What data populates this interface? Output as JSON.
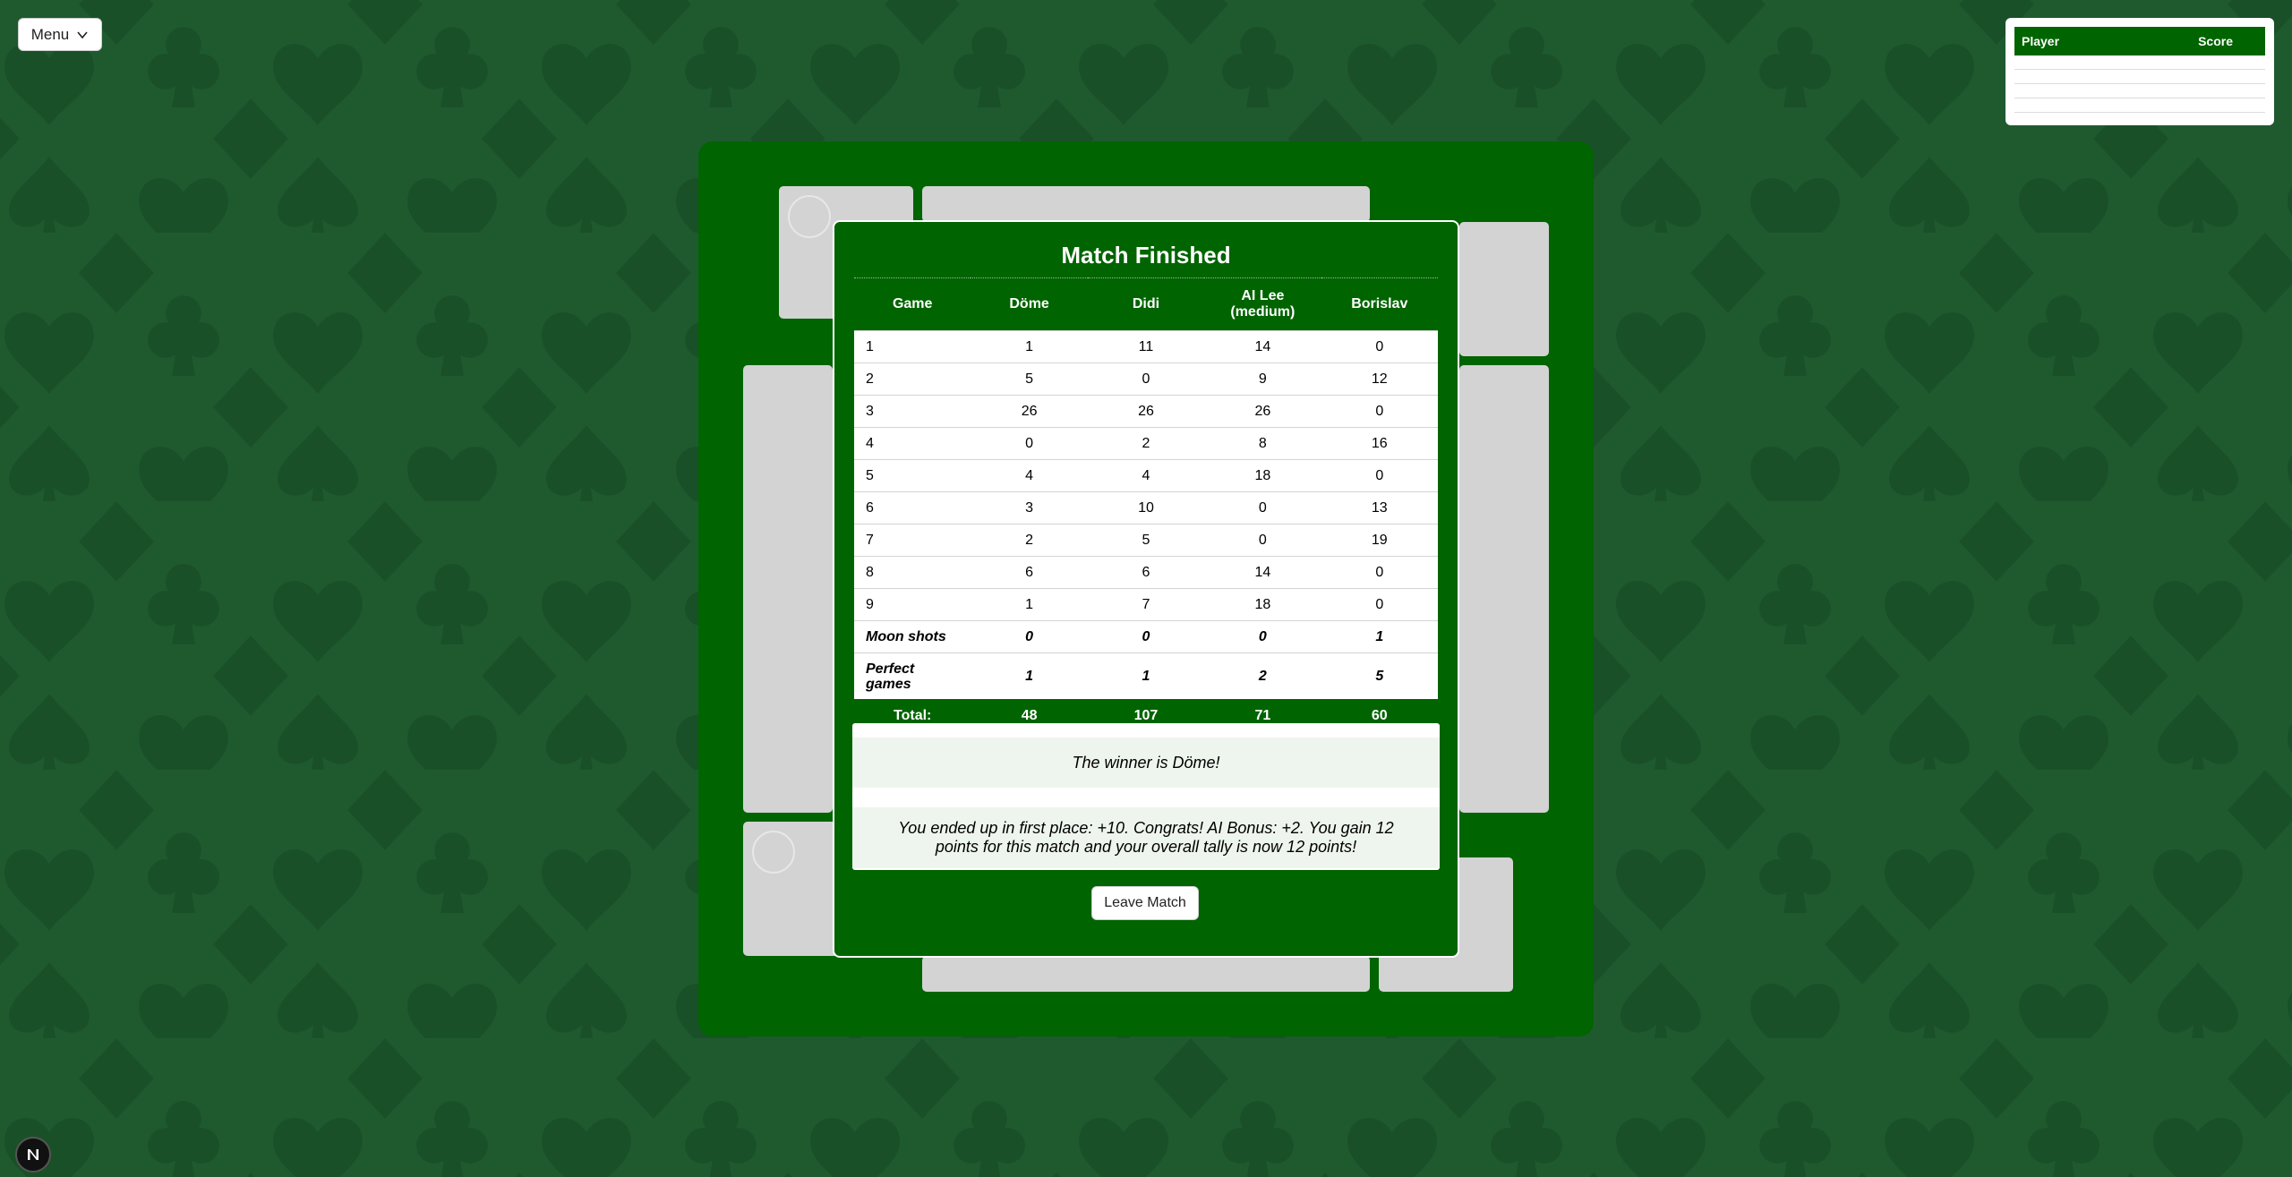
{
  "colors": {
    "background": "#1f5a2f",
    "pattern": "#1a5028",
    "felt": "#006400",
    "card_slot": "#d3d3d3"
  },
  "menu": {
    "label": "Menu",
    "icon": "chevron-down-icon"
  },
  "scoreboard": {
    "player_header": "Player",
    "score_header": "Score"
  },
  "modal": {
    "title": "Match Finished",
    "headers": {
      "game": "Game",
      "p1": "Döme",
      "p2": "Didi",
      "p3_line1": "AI Lee",
      "p3_line2": "(medium)",
      "p4": "Borislav"
    },
    "games": [
      {
        "game": "1",
        "p1": "1",
        "p2": "11",
        "p3": "14",
        "p4": "0"
      },
      {
        "game": "2",
        "p1": "5",
        "p2": "0",
        "p3": "9",
        "p4": "12"
      },
      {
        "game": "3",
        "p1": "26",
        "p2": "26",
        "p3": "26",
        "p4": "0"
      },
      {
        "game": "4",
        "p1": "0",
        "p2": "2",
        "p3": "8",
        "p4": "16"
      },
      {
        "game": "5",
        "p1": "4",
        "p2": "4",
        "p3": "18",
        "p4": "0"
      },
      {
        "game": "6",
        "p1": "3",
        "p2": "10",
        "p3": "0",
        "p4": "13"
      },
      {
        "game": "7",
        "p1": "2",
        "p2": "5",
        "p3": "0",
        "p4": "19"
      },
      {
        "game": "8",
        "p1": "6",
        "p2": "6",
        "p3": "14",
        "p4": "0"
      },
      {
        "game": "9",
        "p1": "1",
        "p2": "7",
        "p3": "18",
        "p4": "0"
      }
    ],
    "moon_shots": {
      "label": "Moon shots",
      "p1": "0",
      "p2": "0",
      "p3": "0",
      "p4": "1"
    },
    "perfect_games": {
      "label_line1": "Perfect",
      "label_line2": "games",
      "p1": "1",
      "p2": "1",
      "p3": "2",
      "p4": "5"
    },
    "totals": {
      "label": "Total:",
      "p1": "48",
      "p2": "107",
      "p3": "71",
      "p4": "60"
    },
    "winner_text": "The winner is Döme!",
    "summary_text": "You ended up in first place: +10. Congrats! AI Bonus: +2. You gain 12 points for this match and your overall tally is now 12 points!",
    "leave_label": "Leave Match"
  },
  "dev_badge": {
    "letter": "N"
  }
}
